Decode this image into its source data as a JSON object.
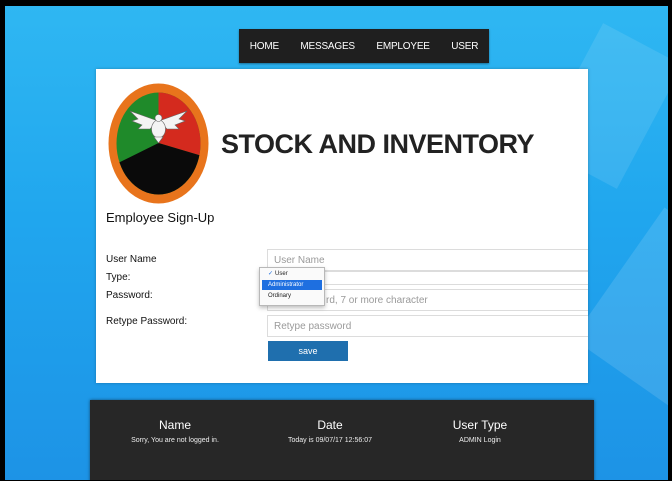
{
  "nav": {
    "items": [
      "HOME",
      "MESSAGES",
      "EMPLOYEE",
      "USER"
    ]
  },
  "brand": {
    "title": "STOCK AND INVENTORY"
  },
  "form": {
    "heading": "Employee Sign-Up",
    "username": {
      "label": "User Name",
      "placeholder": "User Name"
    },
    "type": {
      "label": "Type:",
      "options": [
        "User",
        "Administrator",
        "Ordinary"
      ],
      "selected": "User",
      "highlighted": "Administrator"
    },
    "password": {
      "label": "Password:",
      "placeholder": "rd, 7 or more character"
    },
    "retype": {
      "label": "Retype Password:",
      "placeholder": "Retype password"
    },
    "save_label": "save"
  },
  "footer": {
    "name_header": "Name",
    "name_value": "Sorry, You are not logged in.",
    "date_header": "Date",
    "date_value": "Today is 09/07/17 12:56:07",
    "usertype_header": "User Type",
    "usertype_value": "ADMIN Login"
  },
  "colors": {
    "background": "#20a6ee",
    "nav": "#1f1f1f",
    "button": "#1f6fae",
    "footer": "#272727",
    "highlight": "#1e6fe0"
  }
}
